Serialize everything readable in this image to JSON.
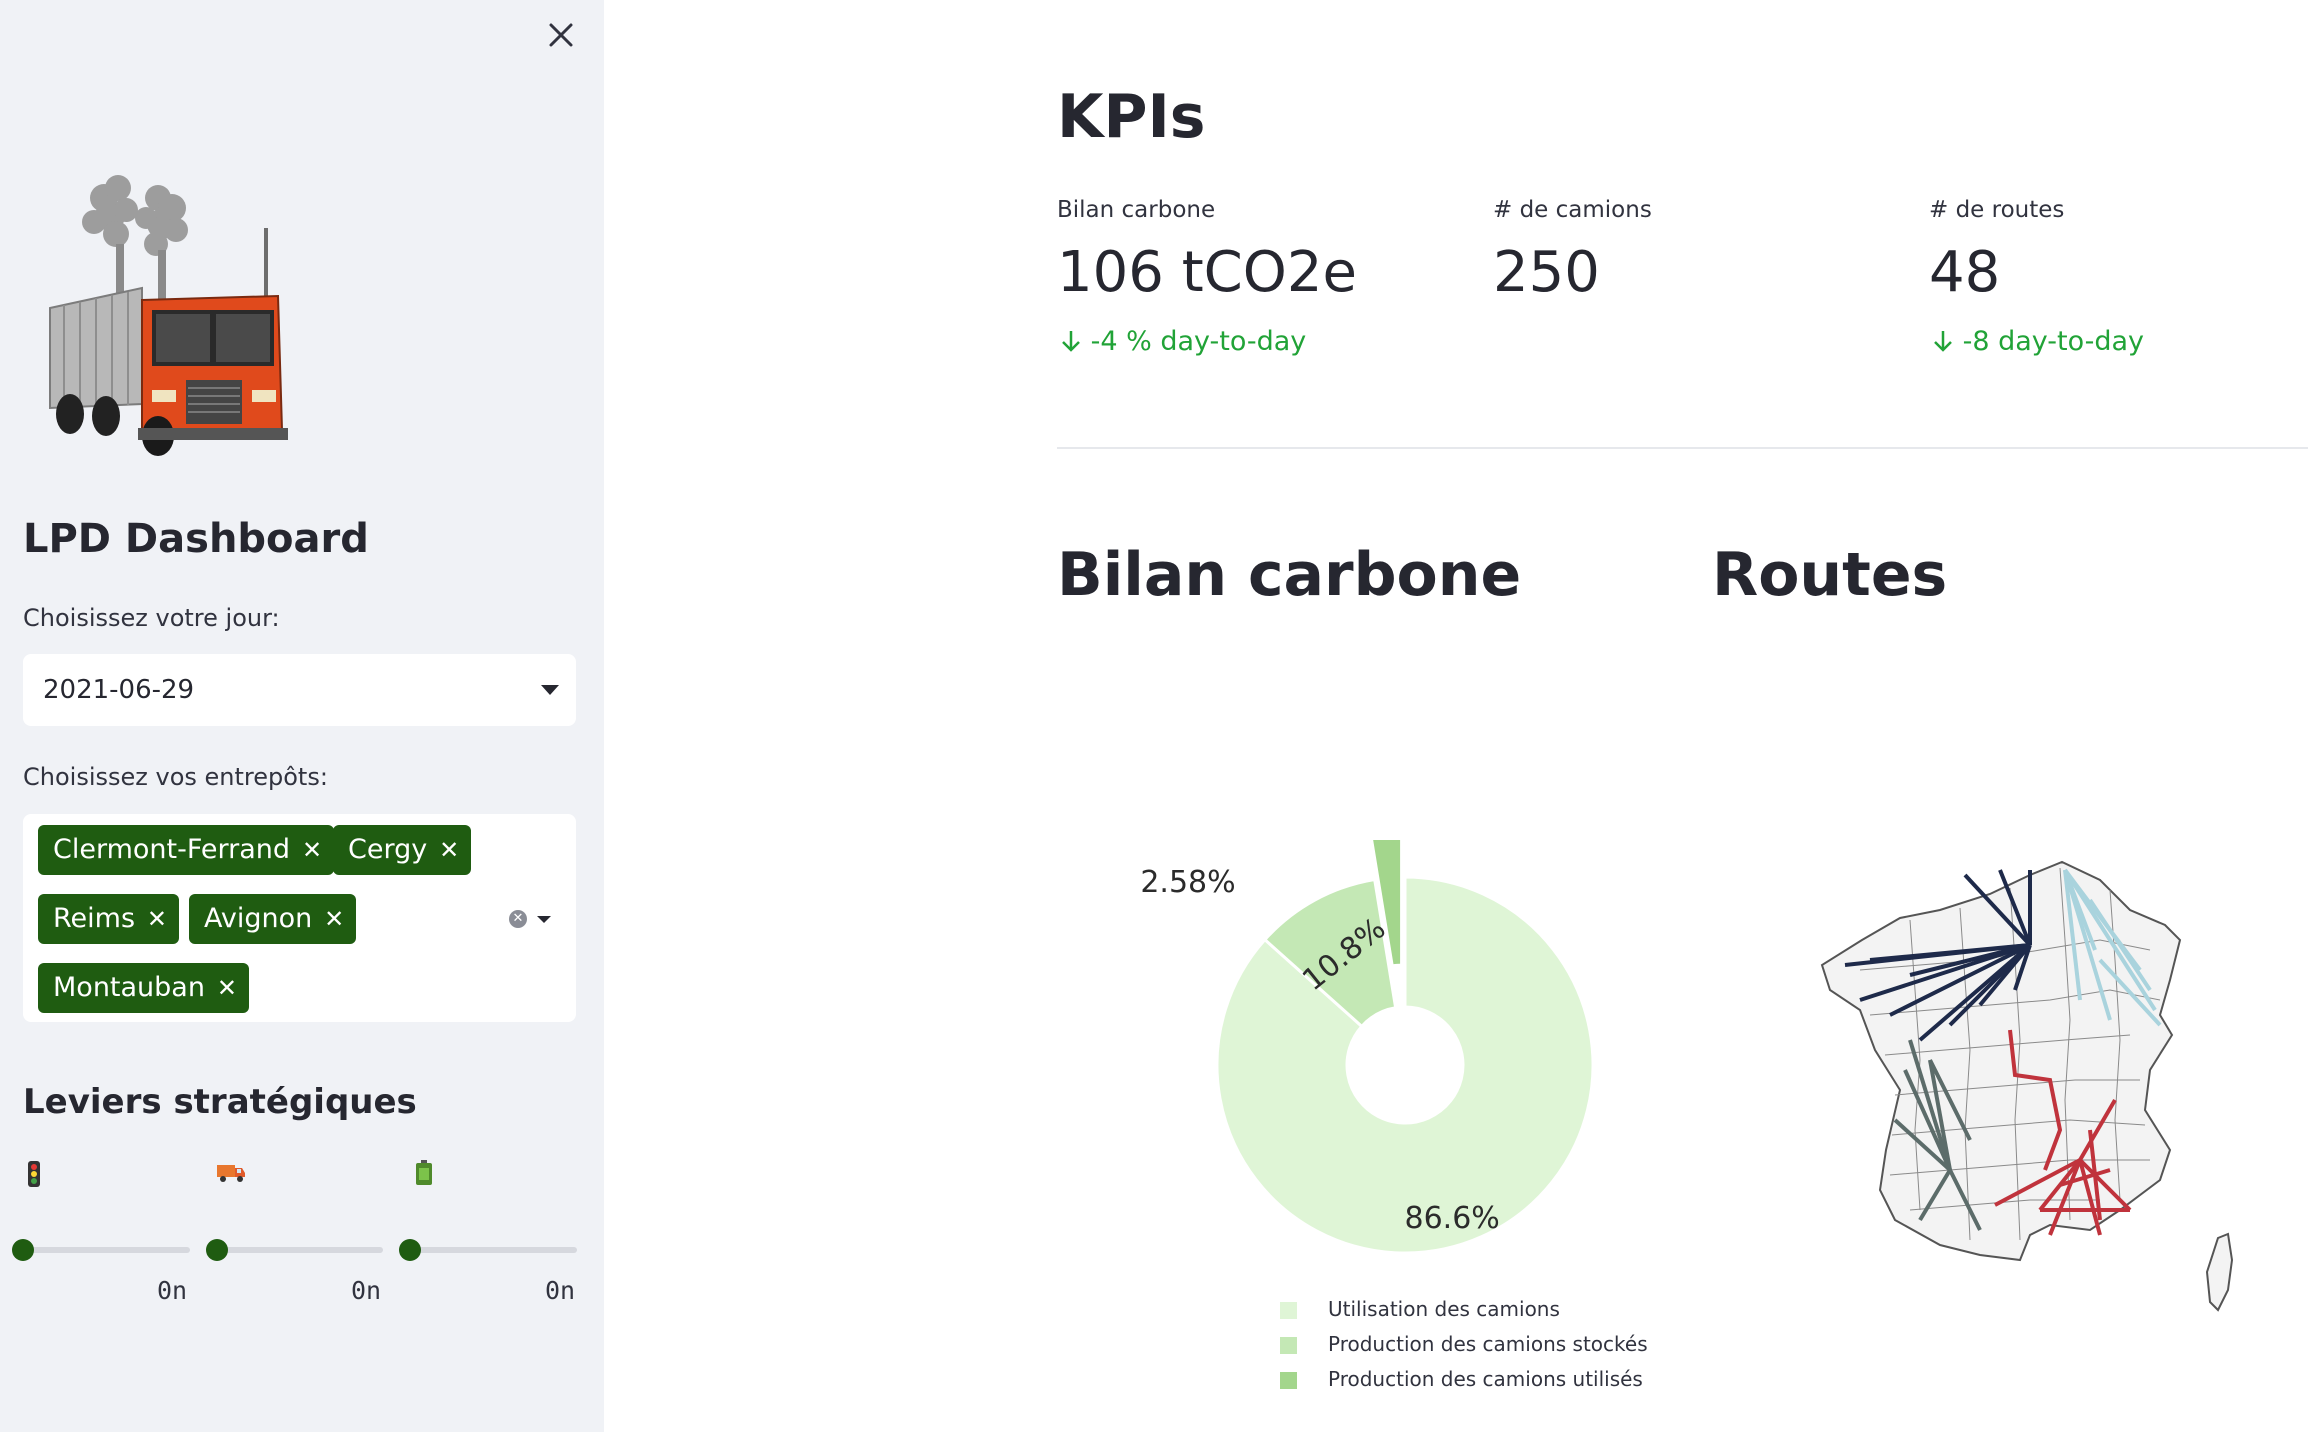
{
  "sidebar": {
    "close_icon": "close-icon",
    "logo_icon": "polluting-truck-illustration",
    "title": "LPD Dashboard",
    "day_label": "Choisissez votre jour:",
    "day_value": "2021-06-29",
    "warehouse_label": "Choisissez vos entrepôts:",
    "warehouses": [
      "Clermont-Ferrand",
      "Cergy",
      "Reims",
      "Avignon",
      "Montauban"
    ],
    "levers_title": "Leviers stratégiques",
    "levers": [
      {
        "icon": "traffic-light-icon",
        "value_text": "0n",
        "level": 0
      },
      {
        "icon": "delivery-truck-icon",
        "value_text": "0n",
        "level": 0
      },
      {
        "icon": "battery-icon",
        "value_text": "0n",
        "level": 0
      }
    ],
    "tag_color": "#1f5c11"
  },
  "kpis": {
    "title": "KPIs",
    "metrics": [
      {
        "label": "Bilan carbone",
        "value": "106 tCO2e",
        "delta": "-4 % day-to-day"
      },
      {
        "label": "# de camions",
        "value": "250",
        "delta": ""
      },
      {
        "label": "# de routes",
        "value": "48",
        "delta": "-8 day-to-day"
      }
    ],
    "delta_color": "#21a337"
  },
  "sections": {
    "carbon_title": "Bilan carbone",
    "routes_title": "Routes"
  },
  "chart_data": {
    "type": "pie",
    "hole": true,
    "categories": [
      "Utilisation des camions",
      "Production des camions stockés",
      "Production des camions utilisés"
    ],
    "values": [
      86.6,
      10.8,
      2.58
    ],
    "labels": [
      "86.6%",
      "10.8%",
      "2.58%"
    ],
    "colors": [
      "#dff5d6",
      "#c4e8b5",
      "#a3d68c"
    ],
    "legend_position": "bottom"
  },
  "map": {
    "region_icon": "france-departments-map",
    "route_colors": [
      "#1e2a4a",
      "#a9d3dd",
      "#5c6c6a",
      "#c0333c"
    ]
  }
}
